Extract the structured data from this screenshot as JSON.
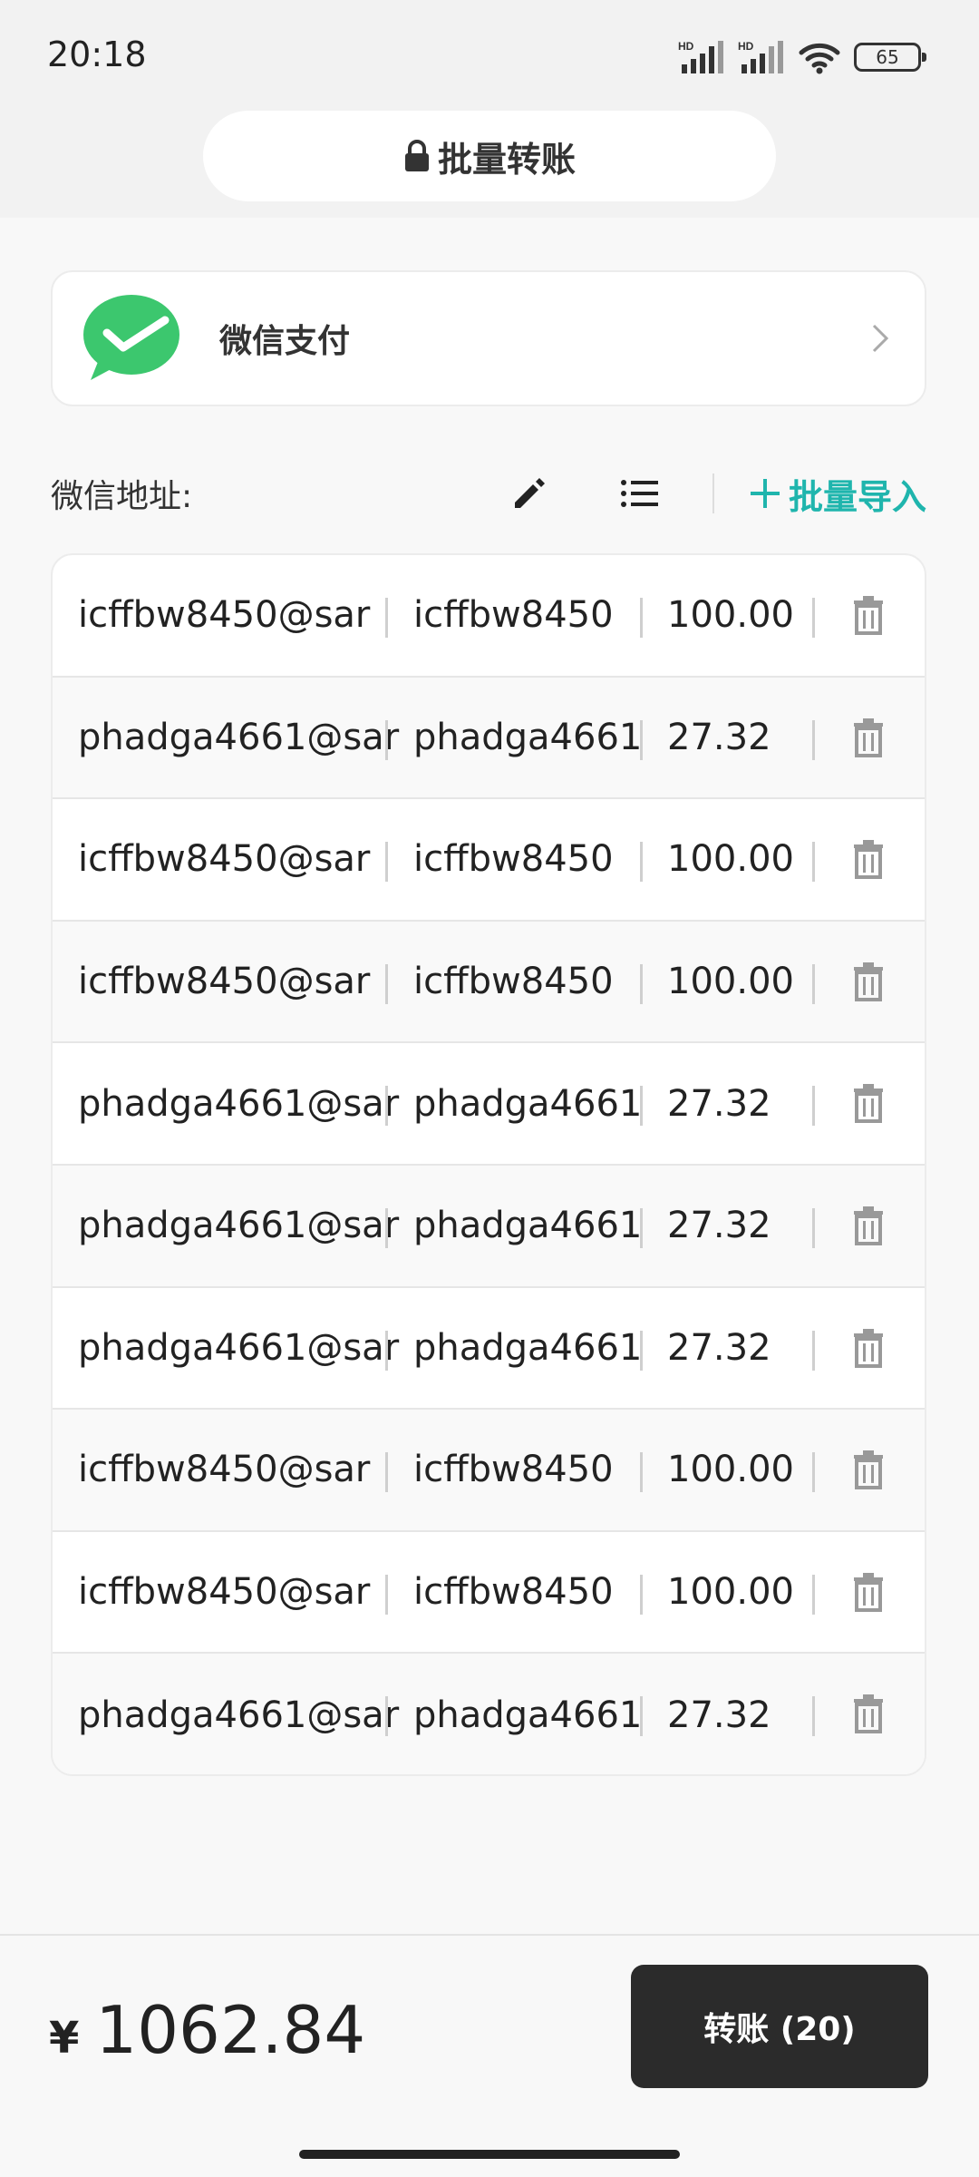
{
  "status": {
    "time": "20:18",
    "battery": "65",
    "signal1": "HD",
    "signal2": "HD"
  },
  "header": {
    "title": "批量转账"
  },
  "payment": {
    "name": "微信支付"
  },
  "address_section": {
    "label": "微信地址:",
    "import_label": "批量导入"
  },
  "rows": [
    {
      "address": "icffbw8450@sar",
      "name": "icffbw8450",
      "amount": "100.00"
    },
    {
      "address": "phadga4661@sar",
      "name": "phadga4661",
      "amount": "27.32"
    },
    {
      "address": "icffbw8450@sar",
      "name": "icffbw8450",
      "amount": "100.00"
    },
    {
      "address": "icffbw8450@sar",
      "name": "icffbw8450",
      "amount": "100.00"
    },
    {
      "address": "phadga4661@sar",
      "name": "phadga4661",
      "amount": "27.32"
    },
    {
      "address": "phadga4661@sar",
      "name": "phadga4661",
      "amount": "27.32"
    },
    {
      "address": "phadga4661@sar",
      "name": "phadga4661",
      "amount": "27.32"
    },
    {
      "address": "icffbw8450@sar",
      "name": "icffbw8450",
      "amount": "100.00"
    },
    {
      "address": "icffbw8450@sar",
      "name": "icffbw8450",
      "amount": "100.00"
    },
    {
      "address": "phadga4661@sar",
      "name": "phadga4661",
      "amount": "27.32"
    }
  ],
  "footer": {
    "currency": "¥",
    "total": "1062.84",
    "transfer_label": "转账 (20)"
  },
  "colors": {
    "accent": "#1fb5ad",
    "wechat_green": "#3cc76e",
    "button_bg": "#2b2b2b"
  }
}
